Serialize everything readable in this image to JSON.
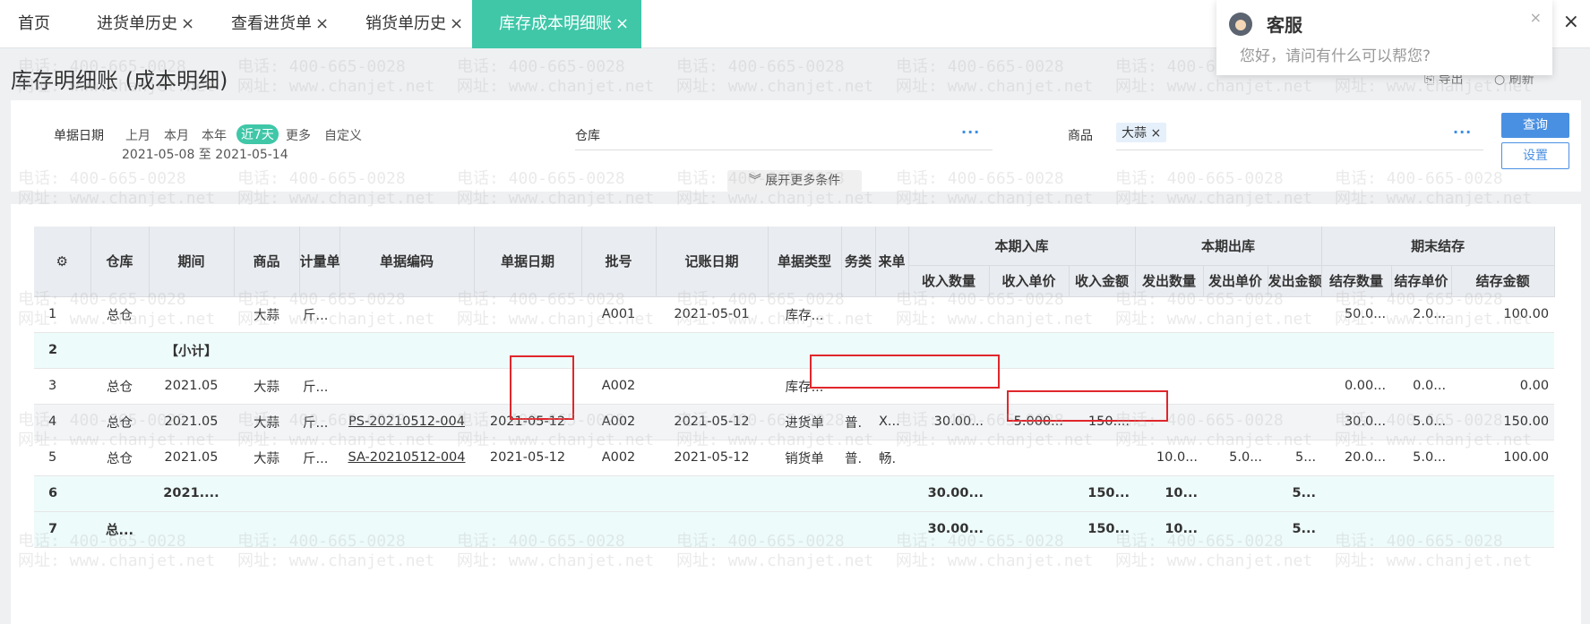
{
  "tabs": [
    {
      "label": "首页",
      "closable": false
    },
    {
      "label": "进货单历史",
      "closable": true
    },
    {
      "label": "查看进货单",
      "closable": true
    },
    {
      "label": "销货单历史",
      "closable": true
    },
    {
      "label": "库存成本明细账",
      "closable": true,
      "active": true
    }
  ],
  "close_glyph": "×",
  "page_title": "库存明细账 (成本明细)",
  "toplinks": {
    "export": "导出",
    "refresh": "刷新"
  },
  "chat": {
    "title": "客服",
    "message": "您好，请问有什么可以帮您?",
    "close": "×"
  },
  "filter": {
    "date_label": "单据日期",
    "date_options": [
      "上月",
      "本月",
      "本年",
      "近7天",
      "更多",
      "自定义"
    ],
    "active_option": "近7天",
    "date_range": "2021-05-08 至 2021-05-14",
    "warehouse_label": "仓库",
    "product_label": "商品",
    "product_chip": "大蒜",
    "more_glyph": "···",
    "query_button": "查询",
    "settings_button": "设置",
    "expand_label": "展开更多条件"
  },
  "table": {
    "headers_top": {
      "warehouse": "仓库",
      "period": "期间",
      "product": "商品",
      "unit": "计量单",
      "doc_no": "单据编码",
      "doc_date": "单据日期",
      "batch": "批号",
      "post_date": "记账日期",
      "doc_type": "单据类型",
      "biz_type": "务类",
      "source": "来单",
      "in_group": "本期入库",
      "out_group": "本期出库",
      "end_group": "期末结存"
    },
    "headers_sub": [
      "收入数量",
      "收入单价",
      "收入金额",
      "发出数量",
      "发出单价",
      "发出金额",
      "结存数量",
      "结存单价",
      "结存金额"
    ],
    "rows": [
      {
        "no": "1",
        "wh": "总仓",
        "period": "",
        "product": "大蒜",
        "unit": "斤...",
        "doc_no": "",
        "doc_date": "",
        "batch": "A001",
        "post_date": "2021-05-01",
        "doc_type": "库存...",
        "biz": "",
        "src": "",
        "in_qty": "",
        "in_price": "",
        "in_amt": "",
        "out_qty": "",
        "out_price": "",
        "out_amt": "",
        "end_qty": "50.0...",
        "end_price": "2.0...",
        "end_amt": "100.00",
        "style": "normal"
      },
      {
        "no": "2",
        "wh": "",
        "period": "【小计】",
        "product": "",
        "unit": "",
        "doc_no": "",
        "doc_date": "",
        "batch": "",
        "post_date": "",
        "doc_type": "",
        "biz": "",
        "src": "",
        "in_qty": "",
        "in_price": "",
        "in_amt": "",
        "out_qty": "",
        "out_price": "",
        "out_amt": "",
        "end_qty": "",
        "end_price": "",
        "end_amt": "",
        "style": "sum"
      },
      {
        "no": "3",
        "wh": "总仓",
        "period": "2021.05",
        "product": "大蒜",
        "unit": "斤...",
        "doc_no": "",
        "doc_date": "",
        "batch": "A002",
        "post_date": "",
        "doc_type": "库存...",
        "biz": "",
        "src": "",
        "in_qty": "",
        "in_price": "",
        "in_amt": "",
        "out_qty": "",
        "out_price": "",
        "out_amt": "",
        "end_qty": "0.00...",
        "end_price": "0.0...",
        "end_amt": "0.00",
        "style": "normal"
      },
      {
        "no": "4",
        "wh": "总仓",
        "period": "2021.05",
        "product": "大蒜",
        "unit": "斤...",
        "doc_no": "PS-20210512-004",
        "doc_date": "2021-05-12",
        "batch": "A002",
        "post_date": "2021-05-12",
        "doc_type": "进货单",
        "biz": "普.",
        "src": "X...",
        "in_qty": "30.00...",
        "in_price": "5.000...",
        "in_amt": "150....",
        "out_qty": "",
        "out_price": "",
        "out_amt": "",
        "end_qty": "30.0...",
        "end_price": "5.0...",
        "end_amt": "150.00",
        "style": "alt"
      },
      {
        "no": "5",
        "wh": "总仓",
        "period": "2021.05",
        "product": "大蒜",
        "unit": "斤...",
        "doc_no": "SA-20210512-004",
        "doc_date": "2021-05-12",
        "batch": "A002",
        "post_date": "2021-05-12",
        "doc_type": "销货单",
        "biz": "普.",
        "src": "畅.",
        "in_qty": "",
        "in_price": "",
        "in_amt": "",
        "out_qty": "10.0...",
        "out_price": "5.0...",
        "out_amt": "5...",
        "end_qty": "20.0...",
        "end_price": "5.0...",
        "end_amt": "100.00",
        "style": "normal"
      },
      {
        "no": "6",
        "wh": "",
        "period": "2021....",
        "product": "",
        "unit": "",
        "doc_no": "",
        "doc_date": "",
        "batch": "",
        "post_date": "",
        "doc_type": "",
        "biz": "",
        "src": "",
        "in_qty": "30.00...",
        "in_price": "",
        "in_amt": "150...",
        "out_qty": "10...",
        "out_price": "",
        "out_amt": "5...",
        "end_qty": "",
        "end_price": "",
        "end_amt": "",
        "style": "sum"
      },
      {
        "no": "7",
        "wh": "总...",
        "period": "",
        "product": "",
        "unit": "",
        "doc_no": "",
        "doc_date": "",
        "batch": "",
        "post_date": "",
        "doc_type": "",
        "biz": "",
        "src": "",
        "in_qty": "30.00...",
        "in_price": "",
        "in_amt": "150...",
        "out_qty": "10...",
        "out_price": "",
        "out_amt": "5...",
        "end_qty": "",
        "end_price": "",
        "end_amt": "",
        "style": "sum"
      }
    ]
  },
  "watermark": {
    "phone": "电话: 400-665-0028",
    "site": "网址: www.chanjet.net"
  }
}
